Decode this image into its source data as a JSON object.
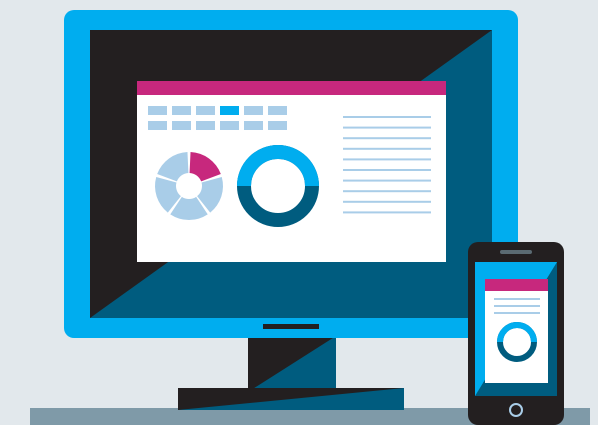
{
  "scene": {
    "description_free": true
  },
  "monitor": {
    "window": {
      "header_color": "#c7287d",
      "tabs": 6,
      "active_tab": 3,
      "text_lines": 10
    },
    "charts": {
      "pie_segments": 5,
      "highlight_segment": 1
    }
  },
  "phone": {
    "header_color": "#c7287d",
    "text_lines": 3
  },
  "colors": {
    "background": "#e2e8ec",
    "accent_blue": "#00adef",
    "dark": "#231f20",
    "navy": "#005c7f",
    "light_blue": "#a9cde8",
    "magenta": "#c7287d",
    "desk": "#7f9aa8"
  }
}
